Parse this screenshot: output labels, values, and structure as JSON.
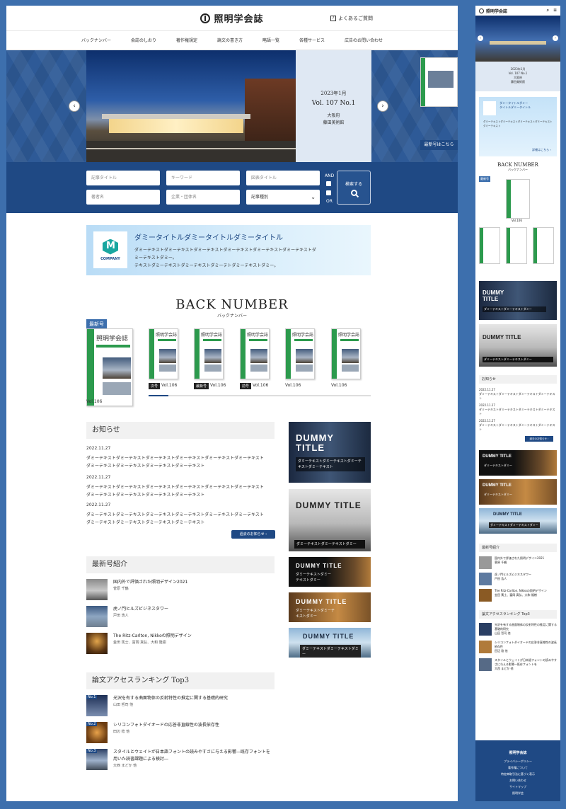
{
  "site": {
    "logo": "照明学会誌",
    "faq": "よくあるご質問"
  },
  "nav": [
    "バックナンバー",
    "会誌のしおり",
    "著作権規定",
    "論文の書き方",
    "略語一覧",
    "各種サービス",
    "広告のお問い合わせ"
  ],
  "hero": {
    "date": "2023年1月",
    "volume": "Vol. 107 No.1",
    "place": "大阪府",
    "building": "藤田美術館",
    "latest_link": "最新号はこちら"
  },
  "search": {
    "article_title": "記事タイトル",
    "keyword": "キーワード",
    "chart_title": "図表タイトル",
    "author": "著者名",
    "company": "企業・団体名",
    "category": "記事種別",
    "and": "AND",
    "or": "OR",
    "button": "検索する"
  },
  "banner": {
    "company": "COMPANY",
    "title": "ダミータイトルダミータイトルダミータイトル",
    "text1": "ダミーテキストダミーテキストダミーテキストダミーテキストダミーテキストダミーテキストダ",
    "text2": "ミーテキストダミー。",
    "text3": "テキストダミーテキストダミーテキストダミーテトダミーテキストダミー。"
  },
  "backnumber": {
    "title": "BACK NUMBER",
    "subtitle": "バックナンバー",
    "new": "最新号",
    "cover_title": "照明学会誌",
    "latest_vol": "Vol.106",
    "items": [
      {
        "tag": "次号",
        "vol": "Vol.106"
      },
      {
        "tag": "最新号",
        "vol": "Vol.106"
      },
      {
        "tag": "前号",
        "vol": "Vol.106"
      },
      {
        "tag": "",
        "vol": "Vol.106"
      },
      {
        "tag": "",
        "vol": "Vol.106"
      }
    ]
  },
  "news": {
    "heading": "お知らせ",
    "items": [
      {
        "date": "2022.11.27",
        "line1": "ダミーテキストダミーテキストダミーテキストダミーテキストダミーテキストダミーテキスト",
        "line2": "ダミーテキストダミーテキストダミーテキストダミーテキスト"
      },
      {
        "date": "2022.11.27",
        "line1": "ダミーテキストダミーテキストダミーテキストダミーテキストダミーテキストダミーテキスト",
        "line2": "ダミーテキストダミーテキストダミーテキストダミーテキスト"
      },
      {
        "date": "2022.11.27",
        "line1": "ダミーテキストダミーテキストダミーテキストダミーテキストダミーテキストダミーテキスト",
        "line2": "ダミーテキストダミーテキストダミーテキストダミーテキスト"
      }
    ],
    "more": "過去のお知らせ ›"
  },
  "latest": {
    "heading": "最新号紹介",
    "items": [
      {
        "title": "国内外で評価された照明デザイン2021",
        "author": "菅原 千鶴"
      },
      {
        "title": "虎ノ門ヒルズビジネスタワー",
        "author": "戸田 浩人"
      },
      {
        "title": "The Ritz-Carlton, Nikkoの照明デザイン",
        "author": "金田 篤士、富岡 真弘、大和 隆樹"
      }
    ]
  },
  "ranking": {
    "heading": "論文アクセスランキング Top3",
    "items": [
      {
        "no": "No.1",
        "title": "光沢を有する曲面物体の反射特性の推定に関する基礎的研究",
        "title2": "",
        "author": "山田 哲司 他"
      },
      {
        "no": "No.2",
        "title": "シリコンフォトダイオードの応答非直線性の波長依存性",
        "title2": "",
        "author": "田辺 稔 他"
      },
      {
        "no": "No.3",
        "title": "スタイルとウェイトが日本語フォントの読みやすさに与える影響―既存フォントを",
        "title2": "用いた読書課題による検討―",
        "author": "大西 まどか 他"
      }
    ]
  },
  "side": {
    "big1": "DUMMY TITLE",
    "big1_sub": "ダミーテキストダミーテキストダミーテキストダミーテキスト",
    "big2": "DUMMY TITLE",
    "big2_sub": "ダミーテキストダミーテキストダミー",
    "small1": "DUMMY TITLE",
    "small1_sub": "ダミーテキストダミーテキストダミー",
    "small2": "DUMMY TITLE",
    "small2_sub": "ダミーテキストダミーテキストダミー",
    "small3": "DUMMY TITLE",
    "small3_sub": "ダミーテキストダミーテキストダミー"
  },
  "mobile": {
    "logo": "照明学会誌",
    "hero_date": "2023年1月",
    "hero_vol": "Vol. 107 No.1",
    "hero_place": "大阪府",
    "hero_building": "藤田美術館",
    "banner_title1": "ダミータイトルダミー",
    "banner_title2": "タイトルダミータイトル",
    "banner_text": "ダミーテキストダミーテキストダミーテキストダミーテキストダミーテキスト",
    "banner_more": "詳細はこちら ›",
    "bn_title": "BACK NUMBER",
    "bn_sub": "バックナンバー",
    "bn_new": "最新号",
    "bn_vol": "Vol.106",
    "card1": "DUMMY TITLE",
    "card1_sub": "ダミーテキストダミーテキストダミー",
    "card2": "DUMMY TITLE",
    "card2_sub": "ダミーテキストダミーテキストダミー",
    "news_heading": "お知らせ",
    "news_date": "2022.11.27",
    "news_text": "ダミーテキストダミーテキストダミーテキストダミーテキスト",
    "news_more": "過去のお知らせ ›",
    "c3": "DUMMY TITLE",
    "c3_sub": "ダミーテキストダミー",
    "c4": "DUMMY TITLE",
    "c4_sub": "ダミーテキストダミー",
    "c5": "DUMMY TITLE",
    "c5_sub": "ダミーテキストダミーテキストダミー",
    "latest_heading": "最新号紹介",
    "ranking_heading": "論文アクセスランキング Top3",
    "footer": [
      "照明学会誌",
      "プライバシーポリシー",
      "著作権について",
      "特定商取引法に基づく表示",
      "お問い合わせ",
      "サイトマップ",
      "照明学会"
    ]
  }
}
